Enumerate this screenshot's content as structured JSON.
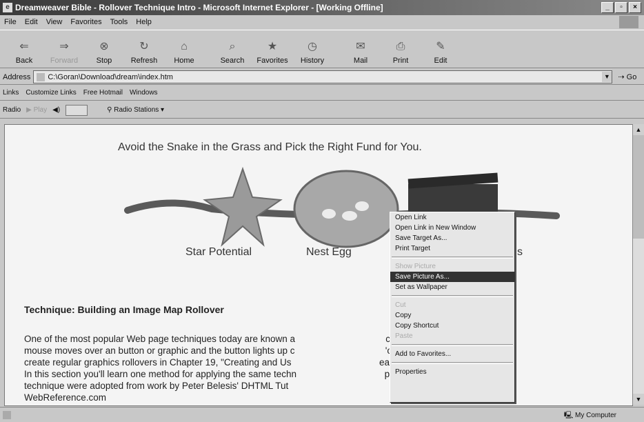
{
  "window": {
    "title": "Dreamweaver Bible - Rollover Technique Intro - Microsoft Internet Explorer - [Working Offline]",
    "buttons": [
      "_",
      "▫",
      "×"
    ]
  },
  "menubar": [
    "File",
    "Edit",
    "View",
    "Favorites",
    "Tools",
    "Help"
  ],
  "toolbar": [
    {
      "label": "Back",
      "icon": "back-arrow-icon",
      "glyph": "⇐"
    },
    {
      "label": "Forward",
      "icon": "forward-arrow-icon",
      "glyph": "⇒"
    },
    {
      "label": "Stop",
      "icon": "stop-icon",
      "glyph": "⊗"
    },
    {
      "label": "Refresh",
      "icon": "refresh-icon",
      "glyph": "↻"
    },
    {
      "label": "Home",
      "icon": "home-icon",
      "glyph": "⌂"
    },
    {
      "label": "Search",
      "icon": "search-icon",
      "glyph": "⌕"
    },
    {
      "label": "Favorites",
      "icon": "favorites-icon",
      "glyph": "★"
    },
    {
      "label": "History",
      "icon": "history-icon",
      "glyph": "◷"
    },
    {
      "label": "Mail",
      "icon": "mail-icon",
      "glyph": "✉"
    },
    {
      "label": "Print",
      "icon": "print-icon",
      "glyph": "⎙"
    },
    {
      "label": "Edit",
      "icon": "edit-icon",
      "glyph": "✎"
    }
  ],
  "address": {
    "label": "Address",
    "value": "C:\\Goran\\Download\\dream\\index.htm",
    "go": "Go"
  },
  "links": {
    "label": "Links",
    "items": [
      "Customize Links",
      "Free Hotmail",
      "Windows"
    ]
  },
  "radio": {
    "label": "Radio",
    "play": "Play",
    "stations": "Radio Stations"
  },
  "page": {
    "headline": "Avoid the Snake in the Grass and Pick the Right Fund for You.",
    "captions": [
      "Star Potential",
      "Nest Egg",
      "s"
    ],
    "heading": "Technique: Building an Image Map Rollover",
    "paragraph_lines": [
      "One of the most popular Web page techniques today are known a                                   curs when a user's",
      "mouse moves over an button or graphic and the button lights up c                                   'ou'll see how to",
      "create regular graphics rollovers in Chapter 19, \"Creating and Us                                  eamweaver Bible.",
      "In this section you'll learn one method for applying the same techn                                  portions of this",
      "technique were adopted from work by Peter Belesis' DHTML Tut",
      "WebReference.com"
    ]
  },
  "context_menu": [
    {
      "label": "Open Link",
      "state": "normal"
    },
    {
      "label": "Open Link in New Window",
      "state": "normal"
    },
    {
      "label": "Save Target As...",
      "state": "normal"
    },
    {
      "label": "Print Target",
      "state": "normal"
    },
    {
      "sep": true
    },
    {
      "label": "Show Picture",
      "state": "disabled"
    },
    {
      "label": "Save Picture As...",
      "state": "selected"
    },
    {
      "label": "Set as Wallpaper",
      "state": "normal"
    },
    {
      "sep": true
    },
    {
      "label": "Cut",
      "state": "disabled"
    },
    {
      "label": "Copy",
      "state": "normal"
    },
    {
      "label": "Copy Shortcut",
      "state": "normal"
    },
    {
      "label": "Paste",
      "state": "disabled"
    },
    {
      "sep": true
    },
    {
      "label": "Add to Favorites...",
      "state": "normal"
    },
    {
      "sep": true
    },
    {
      "label": "Properties",
      "state": "normal"
    }
  ],
  "status": {
    "zone": "My Computer"
  }
}
